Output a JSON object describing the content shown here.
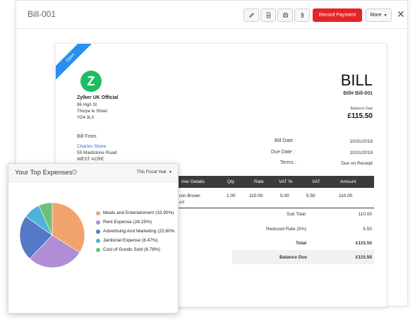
{
  "window": {
    "bill_id": "Bill-001"
  },
  "toolbar": {
    "icons": [
      "pencil-icon",
      "pdf-icon",
      "printer-icon",
      "paperclip-icon"
    ],
    "record_payment_label": "Record Payment",
    "more_label": "More",
    "close_label": "✕"
  },
  "bill": {
    "status_ribbon": "Open",
    "logo_letter": "Z",
    "org": {
      "name": "Zylker UK Official",
      "address": [
        "86 High St",
        "Thorpe le Street",
        "YO4 3LX"
      ]
    },
    "title": "BILL",
    "number": "Bill# Bill-001",
    "balance_due_label": "Balance Due",
    "balance_due_amount": "£115.50",
    "bill_from_label": "Bill From",
    "vendor": {
      "name": "Charles Stone",
      "address": [
        "55 Maidstone Road",
        "WEST ACRE"
      ]
    },
    "meta": [
      {
        "label": "Bill Date :",
        "value": "10/31/2018"
      },
      {
        "label": "Due Date :",
        "value": "10/31/2018"
      },
      {
        "label": "Terms :",
        "value": "Due on Receipt"
      }
    ],
    "table": {
      "columns": [
        "mer Details",
        "Qty",
        "Rate",
        "VAT %",
        "VAT",
        "Amount"
      ],
      "rows": [
        {
          "item": "ron Brown",
          "qty": "1.00",
          "rate": "110.00",
          "vat_pct": "5.00",
          "vat": "5.50",
          "amount": "110.00",
          "sub": "ed"
        }
      ]
    },
    "totals": [
      {
        "label": "Sub Total",
        "value": "110.00"
      },
      {
        "label": "Reduced Rate (5%)",
        "value": "5.50"
      },
      {
        "label": "Total",
        "value": "£115.50"
      },
      {
        "label": "Balance Due",
        "value": "£115.50"
      }
    ]
  },
  "expenses_widget": {
    "title": "Your Top Expenses",
    "help_icon": "?",
    "period": "This Fiscal Year",
    "chart_data": {
      "type": "pie",
      "slices": [
        {
          "name": "Meals and Entertainment",
          "value": 33.9,
          "label": "Meals and Entertainment (33.90%)",
          "color": "#f0a46c"
        },
        {
          "name": "Rent Expense",
          "value": 28.25,
          "label": "Rent Expense (28.25%)",
          "color": "#b08ed6"
        },
        {
          "name": "Advertising And Marketing",
          "value": 22.6,
          "label": "Advertising And Marketing (22.60%",
          "color": "#5479c6"
        },
        {
          "name": "Janitorial Expense",
          "value": 8.47,
          "label": "Janitorial Expense (8.47%)",
          "color": "#4fb3d9"
        },
        {
          "name": "Cost of Goods Sold",
          "value": 6.78,
          "label": "Cost of Goods Sold (6.78%)",
          "color": "#6fbf7a"
        }
      ]
    }
  }
}
